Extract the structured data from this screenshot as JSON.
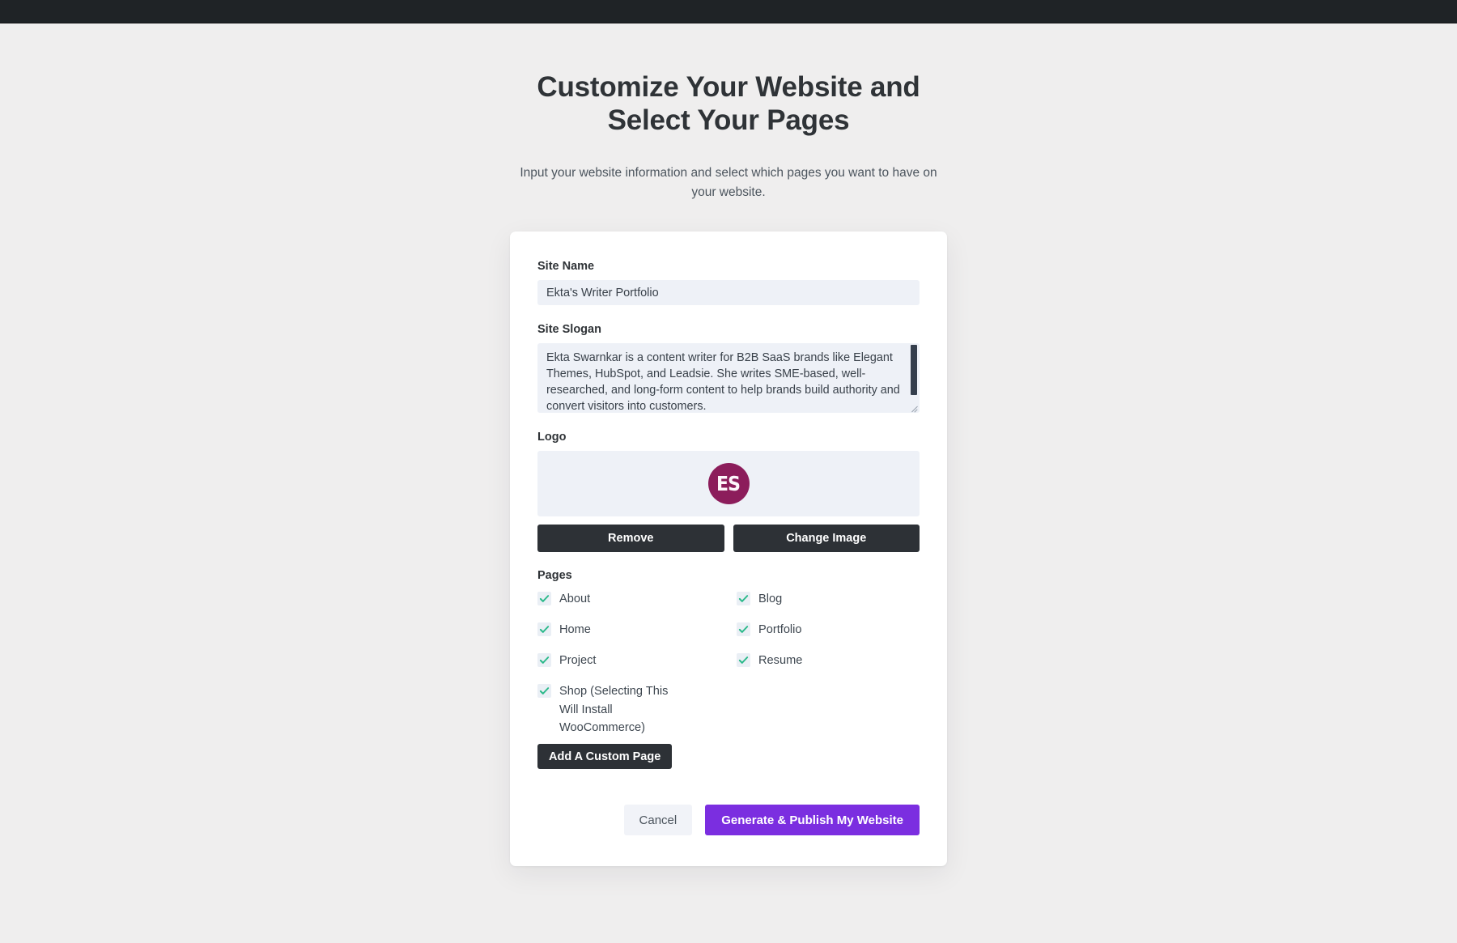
{
  "header": {
    "title": "Customize Your Website and Select Your Pages",
    "subtitle": "Input your website information and select which pages you want to have on your website."
  },
  "form": {
    "site_name": {
      "label": "Site Name",
      "value": "Ekta's Writer Portfolio"
    },
    "site_slogan": {
      "label": "Site Slogan",
      "value": "Ekta Swarnkar is a content writer for B2B SaaS brands like Elegant Themes, HubSpot, and Leadsie. She writes SME-based, well-researched, and long-form content to help brands build authority and convert visitors into customers."
    },
    "logo": {
      "label": "Logo",
      "initials": "ES",
      "circle_color": "#8c1d5b",
      "remove_label": "Remove",
      "change_label": "Change Image"
    },
    "pages": {
      "label": "Pages",
      "items": [
        {
          "label": "About",
          "checked": true
        },
        {
          "label": "Blog",
          "checked": true
        },
        {
          "label": "Home",
          "checked": true
        },
        {
          "label": "Portfolio",
          "checked": true
        },
        {
          "label": "Project",
          "checked": true
        },
        {
          "label": "Resume",
          "checked": true
        },
        {
          "label": "Shop (Selecting This Will Install WooCommerce)",
          "checked": true
        }
      ],
      "add_custom_label": "Add A Custom Page"
    }
  },
  "footer": {
    "cancel_label": "Cancel",
    "primary_label": "Generate & Publish My Website",
    "primary_color": "#7b2ee0"
  },
  "theme": {
    "page_background": "#efeeee",
    "admin_bar": "#1f2326",
    "input_background": "#eef1f7",
    "check_color": "#2bb98a"
  }
}
